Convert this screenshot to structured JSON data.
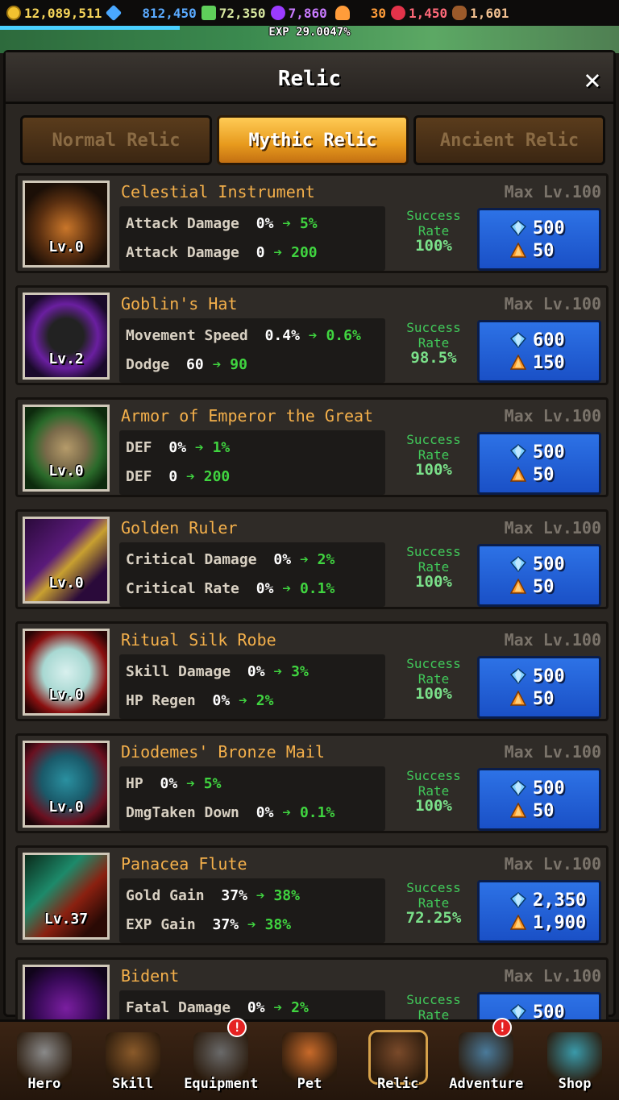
{
  "currencies": [
    {
      "icon": "gold-coin-icon",
      "value": "12,089,511",
      "color": "#f6d55a"
    },
    {
      "icon": "diamond-icon",
      "value": "812,450",
      "color": "#5aaaff"
    },
    {
      "icon": "green-gem-icon",
      "value": "72,350",
      "color": "#d8e8a0"
    },
    {
      "icon": "purple-gem-icon",
      "value": "7,860",
      "color": "#c97bff"
    },
    {
      "icon": "orange-crystal-icon",
      "value": "30",
      "color": "#ff9c3a"
    },
    {
      "icon": "red-gem-icon",
      "value": "1,450",
      "color": "#ff6a7a"
    },
    {
      "icon": "bread-icon",
      "value": "1,601",
      "color": "#f2c191"
    }
  ],
  "exp": {
    "label": "EXP 29.0047%",
    "progress": 0.290047
  },
  "window": {
    "title": "Relic",
    "close_label": "✕"
  },
  "tabs": [
    {
      "label": "Normal Relic",
      "active": false
    },
    {
      "label": "Mythic Relic",
      "active": true
    },
    {
      "label": "Ancient Relic",
      "active": false
    }
  ],
  "success_label_1": "Success",
  "success_label_2": "Rate",
  "relics": [
    {
      "name": "Celestial Instrument",
      "level": "Lv.0",
      "icon": "celestial-instrument-icon",
      "stats": [
        {
          "label": "Attack Damage",
          "from": "0%",
          "to": "5%"
        },
        {
          "label": "Attack Damage",
          "from": "0",
          "to": "200"
        }
      ],
      "success_rate": "100%",
      "max": "Max Lv.100",
      "cost_diamond": "500",
      "cost_crystal": "50"
    },
    {
      "name": "Goblin's Hat",
      "level": "Lv.2",
      "icon": "goblins-hat-icon",
      "stats": [
        {
          "label": "Movement Speed",
          "from": "0.4%",
          "to": "0.6%"
        },
        {
          "label": "Dodge",
          "from": "60",
          "to": "90"
        }
      ],
      "success_rate": "98.5%",
      "max": "Max Lv.100",
      "cost_diamond": "600",
      "cost_crystal": "150"
    },
    {
      "name": "Armor of Emperor the Great",
      "level": "Lv.0",
      "icon": "emperor-armor-icon",
      "stats": [
        {
          "label": "DEF",
          "from": "0%",
          "to": "1%"
        },
        {
          "label": "DEF",
          "from": "0",
          "to": "200"
        }
      ],
      "success_rate": "100%",
      "max": "Max Lv.100",
      "cost_diamond": "500",
      "cost_crystal": "50"
    },
    {
      "name": "Golden Ruler",
      "level": "Lv.0",
      "icon": "golden-ruler-icon",
      "stats": [
        {
          "label": "Critical Damage",
          "from": "0%",
          "to": "2%"
        },
        {
          "label": "Critical Rate",
          "from": "0%",
          "to": "0.1%"
        }
      ],
      "success_rate": "100%",
      "max": "Max Lv.100",
      "cost_diamond": "500",
      "cost_crystal": "50"
    },
    {
      "name": "Ritual Silk Robe",
      "level": "Lv.0",
      "icon": "silk-robe-icon",
      "stats": [
        {
          "label": "Skill Damage",
          "from": "0%",
          "to": "3%"
        },
        {
          "label": "HP Regen",
          "from": "0%",
          "to": "2%"
        }
      ],
      "success_rate": "100%",
      "max": "Max Lv.100",
      "cost_diamond": "500",
      "cost_crystal": "50"
    },
    {
      "name": "Diodemes' Bronze Mail",
      "level": "Lv.0",
      "icon": "bronze-mail-icon",
      "stats": [
        {
          "label": "HP",
          "from": "0%",
          "to": "5%"
        },
        {
          "label": "DmgTaken Down",
          "from": "0%",
          "to": "0.1%"
        }
      ],
      "success_rate": "100%",
      "max": "Max Lv.100",
      "cost_diamond": "500",
      "cost_crystal": "50"
    },
    {
      "name": "Panacea Flute",
      "level": "Lv.37",
      "icon": "panacea-flute-icon",
      "stats": [
        {
          "label": "Gold Gain",
          "from": "37%",
          "to": "38%"
        },
        {
          "label": "EXP Gain",
          "from": "37%",
          "to": "38%"
        }
      ],
      "success_rate": "72.25%",
      "max": "Max Lv.100",
      "cost_diamond": "2,350",
      "cost_crystal": "1,900"
    },
    {
      "name": "Bident",
      "level": "",
      "icon": "bident-icon",
      "stats": [
        {
          "label": "Fatal Damage",
          "from": "0%",
          "to": "2%"
        }
      ],
      "success_rate": "",
      "max": "Max Lv.100",
      "cost_diamond": "500",
      "cost_crystal": ""
    }
  ],
  "nav": [
    {
      "label": "Hero",
      "icon": "hero-helmet-icon",
      "badge": false
    },
    {
      "label": "Skill",
      "icon": "skill-book-icon",
      "badge": false
    },
    {
      "label": "Equipment",
      "icon": "equipment-sword-icon",
      "badge": true
    },
    {
      "label": "Pet",
      "icon": "pet-icon",
      "badge": false
    },
    {
      "label": "Relic",
      "icon": "relic-chest-icon",
      "badge": false,
      "active": true
    },
    {
      "label": "Adventure",
      "icon": "compass-icon",
      "badge": true
    },
    {
      "label": "Shop",
      "icon": "shop-treasure-icon",
      "badge": false
    }
  ],
  "badge_mark": "!"
}
